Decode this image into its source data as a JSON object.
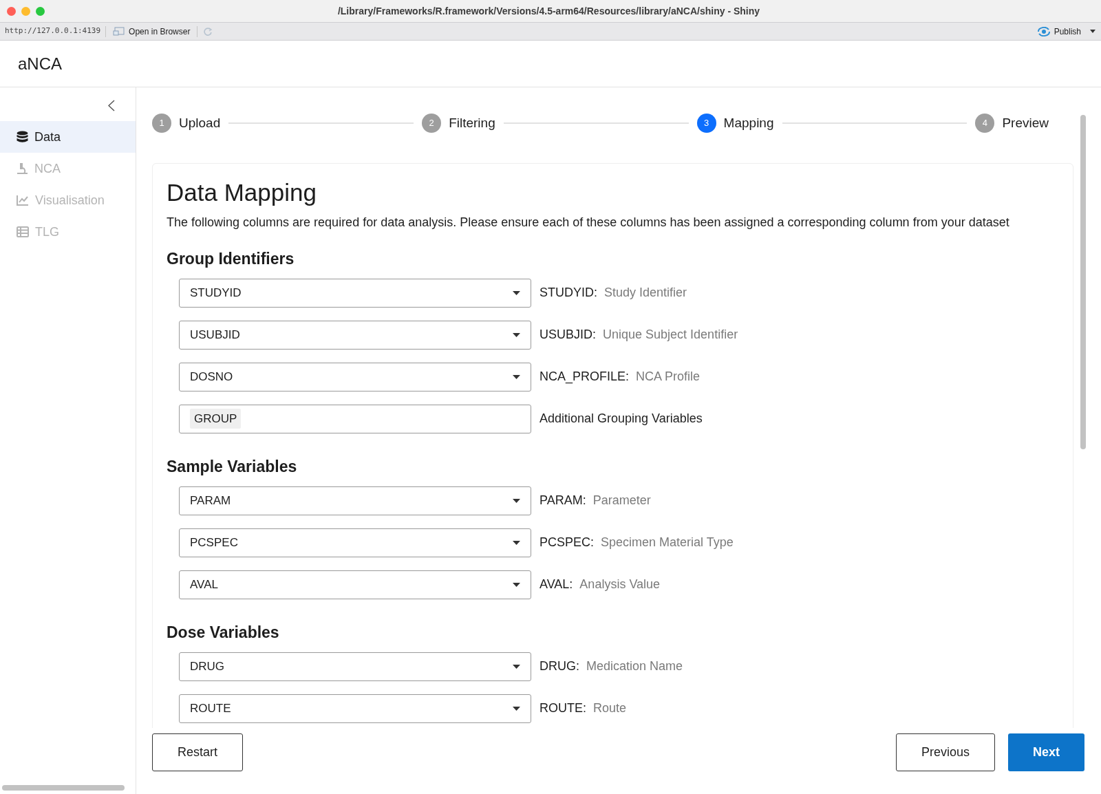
{
  "window": {
    "title": "/Library/Frameworks/R.framework/Versions/4.5-arm64/Resources/library/aNCA/shiny - Shiny"
  },
  "toolbar": {
    "url": "http://127.0.0.1:4139",
    "open_in_browser": "Open in Browser",
    "publish": "Publish"
  },
  "app_title": "aNCA",
  "sidebar": {
    "items": [
      {
        "label": "Data",
        "selected": true,
        "disabled": false,
        "kind": "database"
      },
      {
        "label": "NCA",
        "selected": false,
        "disabled": true,
        "kind": "microscope"
      },
      {
        "label": "Visualisation",
        "selected": false,
        "disabled": true,
        "kind": "chart"
      },
      {
        "label": "TLG",
        "selected": false,
        "disabled": true,
        "kind": "table"
      }
    ]
  },
  "steps": [
    {
      "number": "1",
      "label": "Upload",
      "selected": false
    },
    {
      "number": "2",
      "label": "Filtering",
      "selected": false
    },
    {
      "number": "3",
      "label": "Mapping",
      "selected": true
    },
    {
      "number": "4",
      "label": "Preview",
      "selected": false
    }
  ],
  "card": {
    "title": "Data Mapping",
    "description": "The following columns are required for data analysis. Please ensure each of these columns has been assigned a corresponding column from your dataset",
    "sections": [
      {
        "title": "Group Identifiers",
        "fields": [
          {
            "kind": "select",
            "value": "STUDYID",
            "code": "STUDYID:",
            "description": "Study Identifier"
          },
          {
            "kind": "select",
            "value": "USUBJID",
            "code": "USUBJID:",
            "description": "Unique Subject Identifier"
          },
          {
            "kind": "select",
            "value": "DOSNO",
            "code": "NCA_PROFILE:",
            "description": "NCA Profile"
          },
          {
            "kind": "tags",
            "value": "GROUP",
            "code": "Additional Grouping Variables"
          }
        ]
      },
      {
        "title": "Sample Variables",
        "fields": [
          {
            "kind": "select",
            "value": "PARAM",
            "code": "PARAM:",
            "description": "Parameter"
          },
          {
            "kind": "select",
            "value": "PCSPEC",
            "code": "PCSPEC:",
            "description": "Specimen Material Type"
          },
          {
            "kind": "select",
            "value": "AVAL",
            "code": "AVAL:",
            "description": "Analysis Value"
          }
        ]
      },
      {
        "title": "Dose Variables",
        "fields": [
          {
            "kind": "select",
            "value": "DRUG",
            "code": "DRUG:",
            "description": "Medication Name"
          },
          {
            "kind": "select",
            "value": "ROUTE",
            "code": "ROUTE:",
            "description": "Route"
          }
        ]
      }
    ]
  },
  "footer": {
    "restart": "Restart",
    "previous": "Previous",
    "next": "Next"
  }
}
